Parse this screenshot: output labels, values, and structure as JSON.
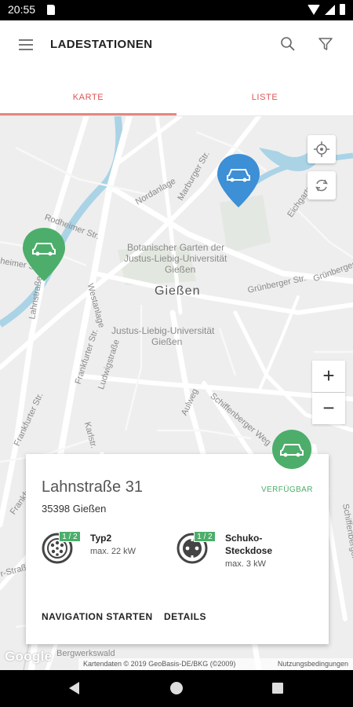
{
  "status_bar": {
    "time": "20:55"
  },
  "app_bar": {
    "title": "LADESTATIONEN"
  },
  "tabs": [
    {
      "label": "KARTE",
      "selected": true
    },
    {
      "label": "LISTE",
      "selected": false
    }
  ],
  "map": {
    "city": "Gießen",
    "labels": {
      "garden1": "Botanischer Garten der",
      "garden2": "Justus-Liebig-Universität",
      "garden3": "Gießen",
      "uni1": "Justus-Liebig-Universität",
      "uni2": "Gießen",
      "nordanlage": "Nordanlage",
      "marburger": "Marburger Str.",
      "rodheimer": "Rodheimer Str.",
      "heimer": "heimer Str.",
      "lahnstrasse": "Lahnstraße",
      "westanlage": "Westanlage",
      "frankfurter1": "Frankfurter Str.",
      "frankfurter2": "Frankfurter Str.",
      "frankfurter3": "Frankfurter Str.",
      "ludwigstrasse": "Ludwigstraße",
      "gruenberger1": "Grünberger Str.",
      "gruenberger2": "Grünberger",
      "eichgarten": "Eichgarten",
      "aulweg": "Aulweg",
      "schiffenberger": "Schiffenberger Weg",
      "schiffenberger2": "Schiffenberger Weg",
      "karlstr": "Karlstr.",
      "str": "r-Straße",
      "bergwerkswald": "Bergwerkswald"
    },
    "attribution": "Kartendaten © 2019 GeoBasis-DE/BKG (©2009)",
    "terms": "Nutzungsbedingungen",
    "google": "Google",
    "zoom_in": "+",
    "zoom_out": "−",
    "pin_colors": {
      "available": "#4cae6a",
      "selected": "#3d8fd6"
    }
  },
  "station": {
    "address": "Lahnstraße 31",
    "zip_city": "35398 Gießen",
    "status": "VERFÜGBAR",
    "connectors": [
      {
        "availability": "1 / 2",
        "name": "Typ2",
        "name2": "",
        "power": "max. 22 kW",
        "icon": "type2-plug-icon"
      },
      {
        "availability": "1 / 2",
        "name": "Schuko-",
        "name2": "Steckdose",
        "power": "max. 3 kW",
        "icon": "schuko-plug-icon"
      }
    ],
    "actions": {
      "navigate": "NAVIGATION STARTEN",
      "details": "DETAILS"
    }
  }
}
